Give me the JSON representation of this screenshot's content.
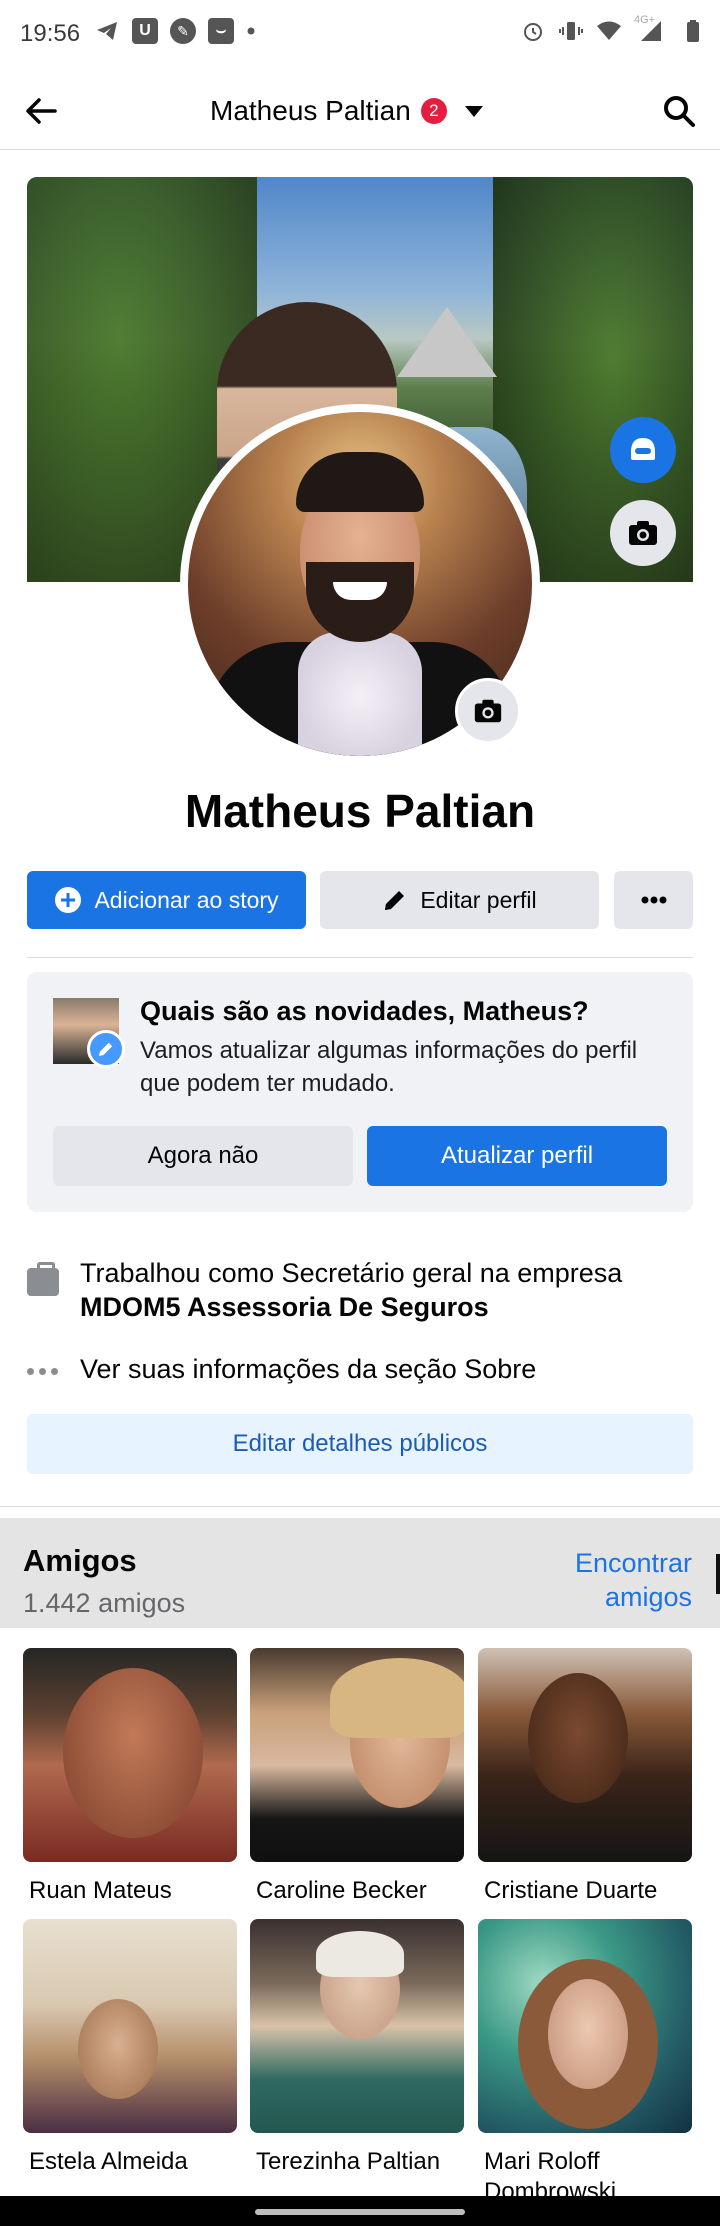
{
  "status_bar": {
    "time": "19:56",
    "network": "4G+",
    "icons_left": [
      "telegram-icon",
      "u-app-icon",
      "app-icon",
      "inbox-icon",
      "dot-icon"
    ],
    "icons_right": [
      "alarm-icon",
      "vibrate-icon",
      "wifi-icon",
      "signal-icon",
      "signal-icon",
      "battery-icon"
    ]
  },
  "header": {
    "title": "Matheus Paltian",
    "notification_count": "2"
  },
  "profile": {
    "name": "Matheus Paltian"
  },
  "actions": {
    "add_story": "Adicionar ao story",
    "edit_profile": "Editar perfil"
  },
  "update_card": {
    "title": "Quais são as novidades, Matheus?",
    "text": "Vamos atualizar algumas informações do perfil que podem ter mudado.",
    "btn_later": "Agora não",
    "btn_update": "Atualizar perfil"
  },
  "intro": {
    "work_prefix": "Trabalhou como Secretário geral na empresa",
    "work_company": "MDOM5 Assessoria De Seguros",
    "about": "Ver suas informações da seção Sobre",
    "edit_public": "Editar detalhes públicos"
  },
  "friends": {
    "title": "Amigos",
    "count": "1.442 amigos",
    "find": "Encontrar amigos",
    "list": [
      {
        "name": "Ruan Mateus"
      },
      {
        "name": "Caroline Becker"
      },
      {
        "name": "Cristiane Duarte"
      },
      {
        "name": "Estela Almeida"
      },
      {
        "name": "Terezinha Paltian"
      },
      {
        "name": "Mari Roloff Dombrowski"
      }
    ]
  },
  "colors": {
    "primary": "#1b74e4",
    "badge": "#e41e3f",
    "secondary_button": "#e4e6eb",
    "light_blue": "#e7f3ff"
  }
}
